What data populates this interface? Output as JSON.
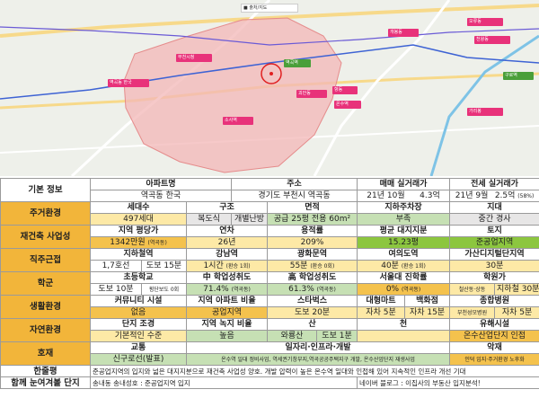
{
  "map": {
    "toolbar_label": "■ 출처/지도",
    "pois": [
      "역곡동 한국",
      "부천시청",
      "역곡역",
      "괴안동",
      "소사역",
      "항동",
      "온수역",
      "개봉동",
      "오류동",
      "천왕동",
      "가리봉",
      "구로역"
    ]
  },
  "colors": {
    "category": "#f2b53a",
    "yellow": "#fde9a6",
    "green": "#c6e0b4",
    "green_dark": "#8cc63f",
    "region": "#f3b7b7"
  },
  "basic": {
    "category": "기본 정보",
    "headers": [
      "아파트명",
      "주소",
      "매매 실거래가",
      "전세 실거래가"
    ],
    "name": "역곡동 한국",
    "address": "경기도 부천시 역곡동",
    "sale_date": "21년 10월",
    "sale_price": "4.3억",
    "jeonse_date": "21년 9월",
    "jeonse_price": "2.5억",
    "jeonse_ratio": "(58%)"
  },
  "housing": {
    "category": "주거환경",
    "headers": [
      "세대수",
      "구조",
      "면적",
      "지하주차장",
      "지대"
    ],
    "households": "497세대",
    "structure": "복도식",
    "heating": "개별난방",
    "area": "공급 25평  전용 60m²",
    "parking": "부족",
    "terrain": "중간 경사"
  },
  "rebuild": {
    "category": "재건축 사업성",
    "headers": [
      "지역 평당가",
      "연차",
      "용적률",
      "평균 대지지분",
      "토지"
    ],
    "price": "1342만원",
    "price_note": "(역곡동)",
    "age": "26년",
    "far": "209%",
    "land_share": "15.23평",
    "land": "준공업지역"
  },
  "commute": {
    "category": "직주근접",
    "headers": [
      "지하철역",
      "강남역",
      "광화문역",
      "여의도역",
      "가산디지털단지역"
    ],
    "station_line": "1,7호선",
    "station_walk": "도보 15분",
    "gangnam": "1시간",
    "gangnam_note": "(환승 1회)",
    "gwanghwamun": "55분",
    "gwanghwamun_note": "(환승 0회)",
    "yeouido": "40분",
    "yeouido_note": "(환승 1회)",
    "gasan": "30분"
  },
  "school": {
    "category": "학군",
    "headers": [
      "초등학교",
      "中 학업성취도",
      "高 학업성취도",
      "서울대 진학률",
      "학원가"
    ],
    "elementary": "도보 10분",
    "crosswalk": "횡단보도 0회",
    "middle": "71.4%",
    "middle_note": "(역곡동)",
    "high": "61.3%",
    "high_note": "(역곡동)",
    "snu": "0%",
    "snu_note": "(역곡동)",
    "academy_name": "철산동·상동",
    "academy_time": "지하철 30분"
  },
  "life": {
    "category": "생활환경",
    "headers": [
      "커뮤니티 시설",
      "지역 아파트 비율",
      "스타벅스",
      "대형마트",
      "백화점",
      "종합병원"
    ],
    "community": "없음",
    "apt_ratio": "공업지역",
    "starbucks": "도보 20분",
    "mart": "자차 5분",
    "dept": "자차 15분",
    "hospital_name": "부천성모병원",
    "hospital_time": "자차 5분"
  },
  "nature": {
    "category": "자연환경",
    "headers": [
      "단지 조경",
      "지역 녹지 비율",
      "산",
      "천",
      "유해시설"
    ],
    "landscape": "기본적인 수준",
    "green_ratio": "높음",
    "mountain_name": "와룡산",
    "mountain_time": "도보 1분",
    "stream": "",
    "hazard": "온수산업단지 인접"
  },
  "benefit": {
    "category": "호재",
    "headers": [
      "교통",
      "일자리·인프라·개발",
      "악재"
    ],
    "transport": "신구로선(발표)",
    "jobs": "온수역 일대 정비사업, 역세권기창부지,역곡공공주택지구 개발, 온수산업단지 재생사업",
    "bad": "인덕 입지·주거환경 노후화"
  },
  "summary": {
    "category": "한줄평",
    "text": "준공업지역의 입지와 넓은 대지지분으로 재건축 사업성 양호. 개발 압력이 높은 온수역 일대와 인접해 있어 지속적인 인프라 개선 기대"
  },
  "together": {
    "category": "함께 눈여겨볼 단지",
    "text": "송내동 송내성호 : 준공업지역 입지",
    "blog": "네이버 블로그 : 이집사의 부동산 입지분석!"
  }
}
